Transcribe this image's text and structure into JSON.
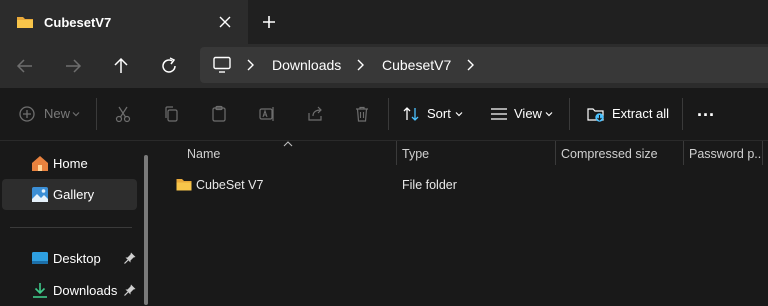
{
  "tab": {
    "title": "CubesetV7"
  },
  "breadcrumb": {
    "items": [
      "Downloads",
      "CubesetV7"
    ]
  },
  "toolbar": {
    "new_label": "New",
    "sort_label": "Sort",
    "view_label": "View",
    "extract_label": "Extract all",
    "more_label": "..."
  },
  "sidebar": {
    "items": [
      {
        "label": "Home"
      },
      {
        "label": "Gallery"
      },
      {
        "label": "Desktop"
      },
      {
        "label": "Downloads"
      }
    ]
  },
  "columns": [
    "Name",
    "Type",
    "Compressed size",
    "Password p..."
  ],
  "rows": [
    {
      "name": "CubeSet V7",
      "type": "File folder",
      "compressed_size": "",
      "password": ""
    }
  ],
  "colors": {
    "accent": "#4cc2ff",
    "folder": "#f8c54a",
    "background": "#191919"
  }
}
